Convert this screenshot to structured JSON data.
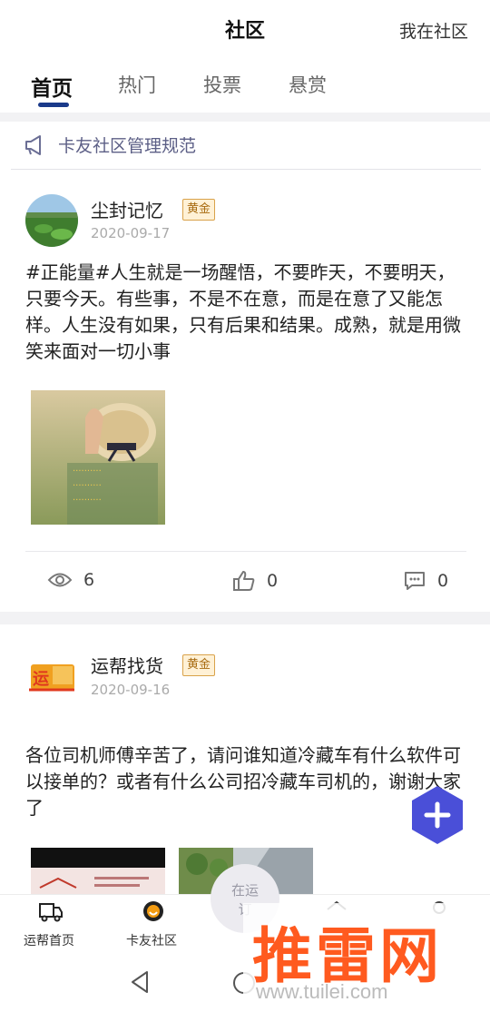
{
  "header": {
    "title": "社区",
    "my_community": "我在社区"
  },
  "tabs": [
    {
      "label": "首页",
      "active": true
    },
    {
      "label": "热门",
      "active": false
    },
    {
      "label": "投票",
      "active": false
    },
    {
      "label": "悬赏",
      "active": false
    }
  ],
  "notice": {
    "text": "卡友社区管理规范",
    "icon": "megaphone-icon"
  },
  "posts": [
    {
      "username": "尘封记忆",
      "badge": "黄金",
      "date": "2020-09-17",
      "content": "#正能量#人生就是一场醒悟，不要昨天，不要明天，只要今天。有些事，不是不在意，而是在意了又能怎样。人生没有如果，只有后果和结果。成熟，就是用微笑来面对一切小事",
      "views": "6",
      "likes": "0",
      "comments": "0"
    },
    {
      "username": "运帮找货",
      "badge": "黄金",
      "date": "2020-09-16",
      "content": "各位司机师傅辛苦了，请问谁知道冷藏车有什么软件可以接单的？或者有什么公司招冷藏车司机的，谢谢大家了"
    }
  ],
  "bottom_nav": {
    "home_label": "运帮首页",
    "community_label": "卡友社区",
    "center_line1": "在运",
    "center_line2": "订"
  },
  "watermark": {
    "text": "推雷网",
    "url": "www.tuilei.com"
  },
  "colors": {
    "accent": "#1a3a8a",
    "fab": "#4a4fd8",
    "badge_border": "#d9a24a",
    "watermark": "#ff5a1f"
  }
}
